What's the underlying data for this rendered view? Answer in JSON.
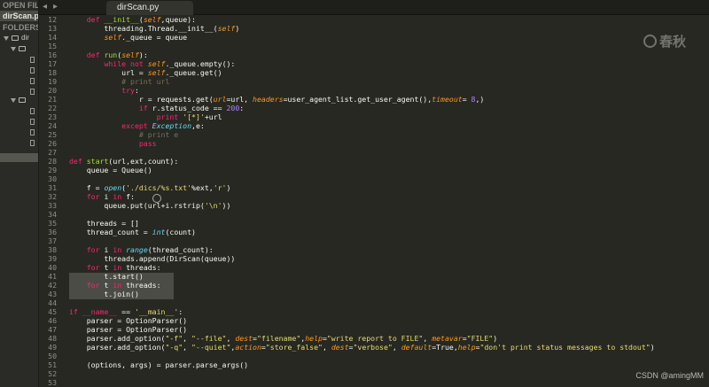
{
  "sidebar": {
    "open_files_header": "OPEN FILES",
    "open_file": "dirScan.py",
    "folders_header": "FOLDERS",
    "root_folder": "dir"
  },
  "tabbar": {
    "back_icon": "chevron-left-icon",
    "forward_icon": "chevron-right-icon",
    "active_tab": "dirScan.py"
  },
  "watermark": {
    "text": "春秋"
  },
  "credit": {
    "text": "CSDN @amingMM"
  },
  "editor": {
    "lines": [
      {
        "n": "12",
        "code": "    def __init__(self,queue):"
      },
      {
        "n": "13",
        "code": "        threading.Thread.__init__(self)"
      },
      {
        "n": "14",
        "code": "        self._queue = queue"
      },
      {
        "n": "15",
        "code": ""
      },
      {
        "n": "16",
        "code": "    def run(self):"
      },
      {
        "n": "17",
        "code": "        while not self._queue.empty():"
      },
      {
        "n": "18",
        "code": "            url = self._queue.get()"
      },
      {
        "n": "19",
        "code": "            # print url"
      },
      {
        "n": "20",
        "code": "            try:"
      },
      {
        "n": "21",
        "code": "                r = requests.get(url=url, headers=user_agent_list.get_user_agent(),timeout= 8,)"
      },
      {
        "n": "22",
        "code": "                if r.status_code == 200:"
      },
      {
        "n": "23",
        "code": "                    print '[*]'+url"
      },
      {
        "n": "24",
        "code": "            except Exception,e:"
      },
      {
        "n": "25",
        "code": "                # print e"
      },
      {
        "n": "26",
        "code": "                pass"
      },
      {
        "n": "27",
        "code": ""
      },
      {
        "n": "28",
        "code": "def start(url,ext,count):"
      },
      {
        "n": "29",
        "code": "    queue = Queue()"
      },
      {
        "n": "30",
        "code": ""
      },
      {
        "n": "31",
        "code": "    f = open('./dics/%s.txt'%ext,'r')"
      },
      {
        "n": "32",
        "code": "    for i in f:"
      },
      {
        "n": "33",
        "code": "        queue.put(url+i.rstrip('\\n'))"
      },
      {
        "n": "34",
        "code": ""
      },
      {
        "n": "35",
        "code": "    threads = []"
      },
      {
        "n": "36",
        "code": "    thread_count = int(count)"
      },
      {
        "n": "37",
        "code": ""
      },
      {
        "n": "38",
        "code": "    for i in range(thread_count):"
      },
      {
        "n": "39",
        "code": "        threads.append(DirScan(queue))"
      },
      {
        "n": "40",
        "code": "    for t in threads:"
      },
      {
        "n": "41",
        "code": "        t.start()"
      },
      {
        "n": "42",
        "code": "    for t in threads:"
      },
      {
        "n": "43",
        "code": "        t.join()"
      },
      {
        "n": "44",
        "code": ""
      },
      {
        "n": "45",
        "code": "if __name__ == '__main__':"
      },
      {
        "n": "46",
        "code": "    parser = OptionParser()"
      },
      {
        "n": "47",
        "code": "    parser = OptionParser()"
      },
      {
        "n": "48",
        "code": "    parser.add_option(\"-f\", \"--file\", dest=\"filename\",help=\"write report to FILE\", metavar=\"FILE\")"
      },
      {
        "n": "49",
        "code": "    parser.add_option(\"-q\", \"--quiet\",action=\"store_false\", dest=\"verbose\", default=True,help=\"don't print status messages to stdout\")"
      },
      {
        "n": "50",
        "code": ""
      },
      {
        "n": "51",
        "code": "    (options, args) = parser.parse_args()"
      },
      {
        "n": "52",
        "code": ""
      },
      {
        "n": "53",
        "code": ""
      }
    ]
  }
}
